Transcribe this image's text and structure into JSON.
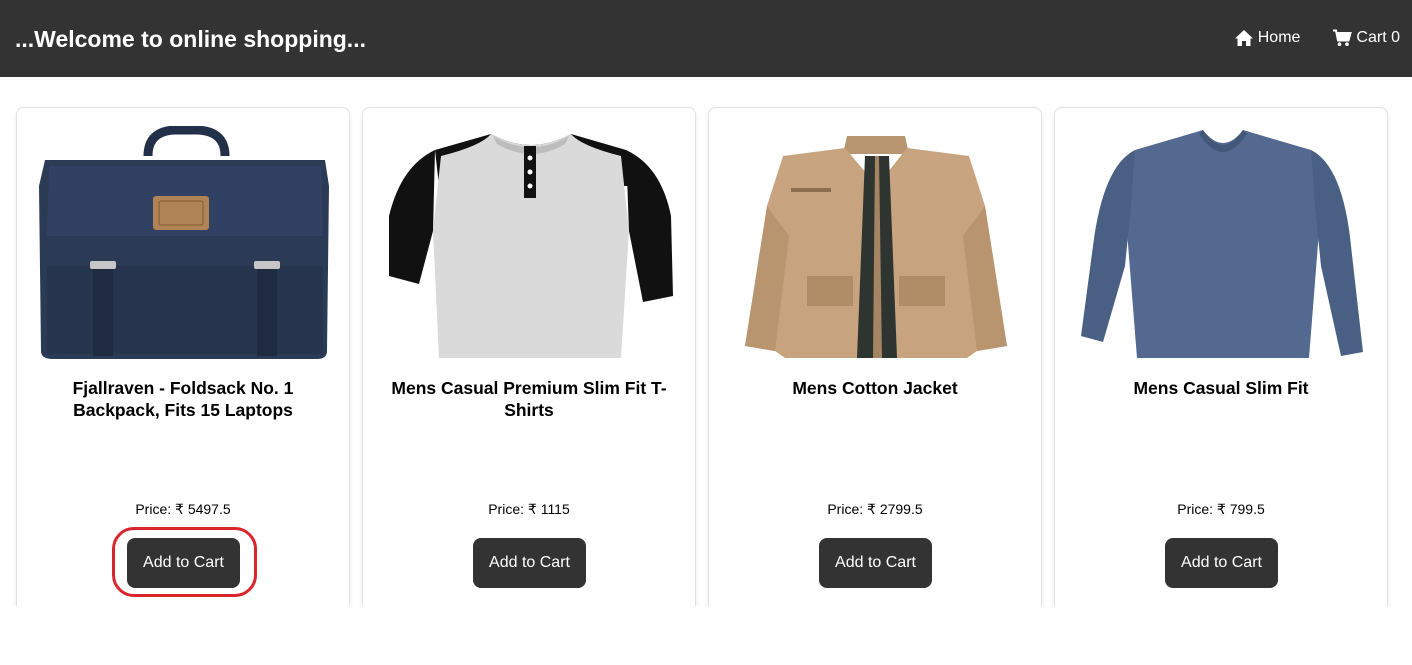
{
  "header": {
    "title": "...Welcome to online shopping...",
    "home_label": "Home",
    "cart_label": "Cart 0"
  },
  "products": [
    {
      "title": "Fjallraven - Foldsack No. 1 Backpack, Fits 15 Laptops",
      "price": "Price: ₹ 5497.5",
      "button": "Add to Cart",
      "image": "navy-backpack-image"
    },
    {
      "title": "Mens Casual Premium Slim Fit T-Shirts",
      "price": "Price: ₹ 1115",
      "button": "Add to Cart",
      "image": "raglan-tshirt-image"
    },
    {
      "title": "Mens Cotton Jacket",
      "price": "Price: ₹ 2799.5",
      "button": "Add to Cart",
      "image": "khaki-jacket-image"
    },
    {
      "title": "Mens Casual Slim Fit",
      "price": "Price: ₹ 799.5",
      "button": "Add to Cart",
      "image": "blue-longsleeve-image"
    }
  ],
  "colors": {
    "header_bg": "#333333",
    "button_bg": "#333333",
    "highlight": "#d9262c"
  }
}
